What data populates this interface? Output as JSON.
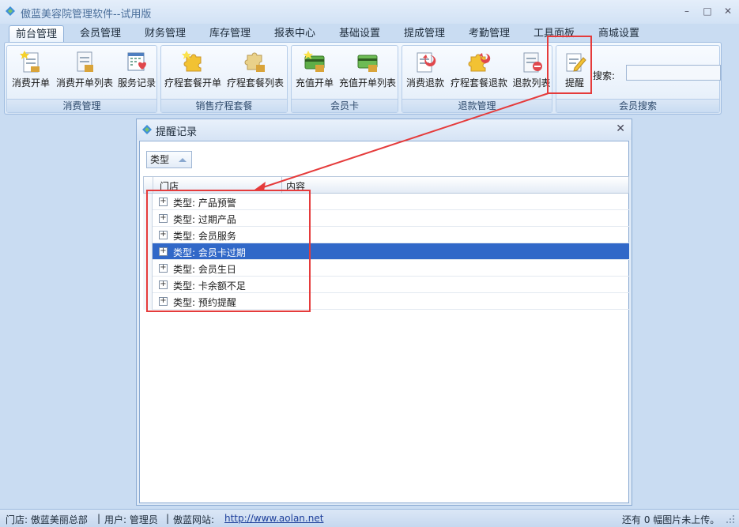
{
  "window": {
    "title": "傲蓝美容院管理软件--试用版",
    "minimize": "–",
    "maximize": "□",
    "close": "✕"
  },
  "tabs": [
    {
      "label": "前台管理",
      "active": true
    },
    {
      "label": "会员管理"
    },
    {
      "label": "财务管理"
    },
    {
      "label": "库存管理"
    },
    {
      "label": "报表中心"
    },
    {
      "label": "基础设置"
    },
    {
      "label": "提成管理"
    },
    {
      "label": "考勤管理"
    },
    {
      "label": "工具面板"
    },
    {
      "label": "商城设置"
    }
  ],
  "ribbon": {
    "groups": [
      {
        "label": "消费管理",
        "buttons": [
          {
            "label": "消费开单",
            "icon": "document-star-icon"
          },
          {
            "label": "消费开单列表",
            "icon": "document-list-icon"
          },
          {
            "label": "服务记录",
            "icon": "calendar-heart-icon"
          }
        ]
      },
      {
        "label": "销售疗程套餐",
        "buttons": [
          {
            "label": "疗程套餐开单",
            "icon": "puzzle-star-icon"
          },
          {
            "label": "疗程套餐列表",
            "icon": "puzzle-list-icon"
          }
        ]
      },
      {
        "label": "会员卡",
        "buttons": [
          {
            "label": "充值开单",
            "icon": "card-star-icon"
          },
          {
            "label": "充值开单列表",
            "icon": "card-list-icon"
          }
        ]
      },
      {
        "label": "退款管理",
        "buttons": [
          {
            "label": "消费退款",
            "icon": "document-refund-icon"
          },
          {
            "label": "疗程套餐退款",
            "icon": "puzzle-refund-icon"
          },
          {
            "label": "退款列表",
            "icon": "list-remove-icon"
          }
        ]
      },
      {
        "label": "会员搜索",
        "buttons": [
          {
            "label": "提醒",
            "icon": "note-pen-icon"
          }
        ],
        "search_label": "搜索:",
        "search_value": ""
      }
    ]
  },
  "dialog": {
    "title": "提醒记录",
    "close": "✕",
    "group_by": "类型",
    "columns": [
      "门店",
      "内容"
    ],
    "rows": [
      {
        "label": "类型: 产品预警",
        "selected": false
      },
      {
        "label": "类型: 过期产品",
        "selected": false
      },
      {
        "label": "类型: 会员服务",
        "selected": false
      },
      {
        "label": "类型: 会员卡过期",
        "selected": true
      },
      {
        "label": "类型: 会员生日",
        "selected": false
      },
      {
        "label": "类型: 卡余额不足",
        "selected": false
      },
      {
        "label": "类型: 预约提醒",
        "selected": false
      }
    ],
    "expander": "+"
  },
  "statusbar": {
    "store": "门店: 傲蓝美丽总部",
    "sep1": "|",
    "user": "用户: 管理员",
    "sep2": "|",
    "site_label": "傲蓝网站:",
    "site_url": "http://www.aolan.net",
    "upload": "还有 0 幅图片未上传。"
  },
  "colors": {
    "highlight": "#e53b3b",
    "selection": "#3168c8"
  }
}
